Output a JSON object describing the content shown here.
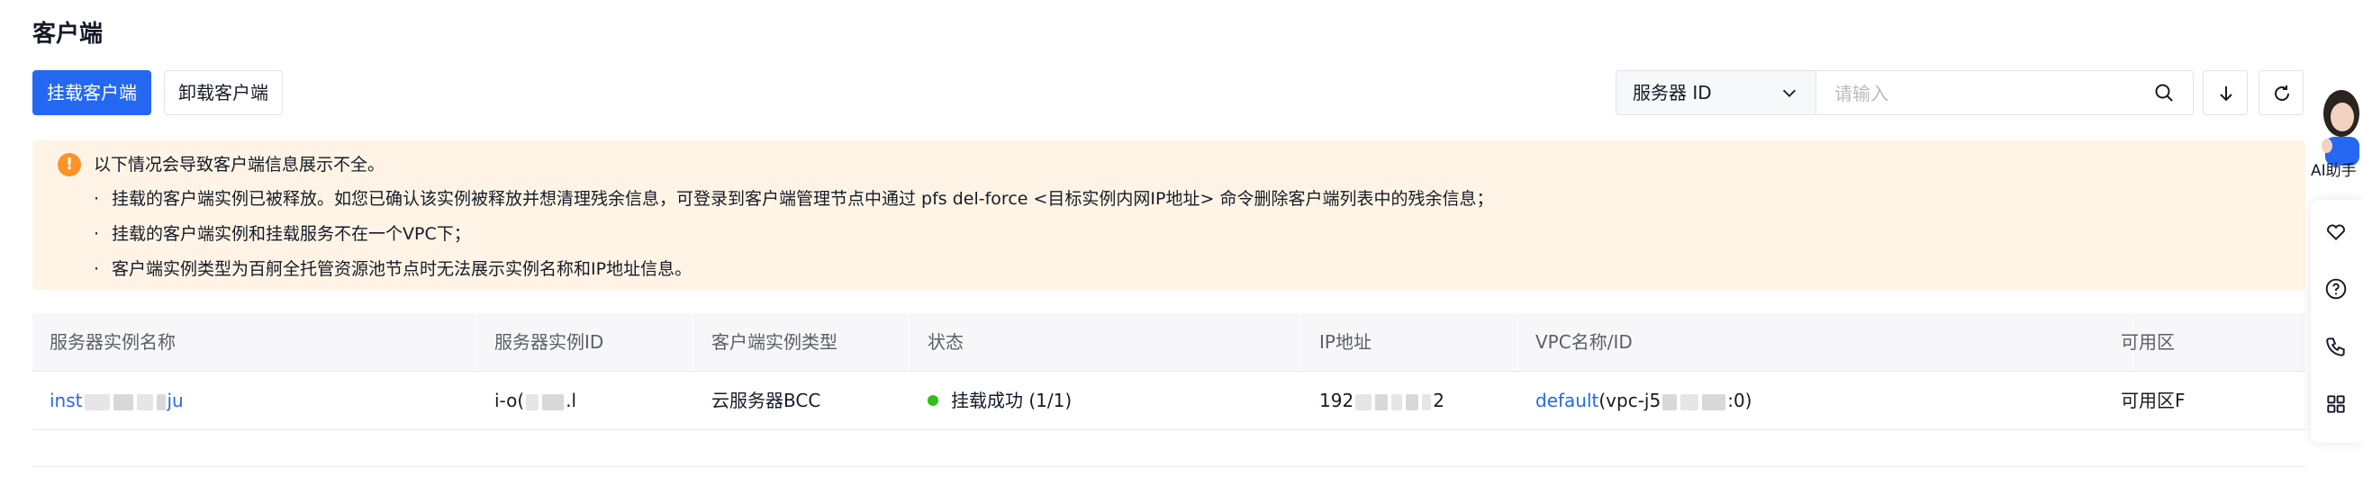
{
  "page": {
    "title": "客户端"
  },
  "toolbar": {
    "mount_button": "挂载客户端",
    "unmount_button": "卸载客户端",
    "filter_select": "服务器 ID",
    "search_placeholder": "请输入"
  },
  "alert": {
    "heading": "以下情况会导致客户端信息展示不全。",
    "items": [
      "挂载的客户端实例已被释放。如您已确认该实例被释放并想清理残余信息，可登录到客户端管理节点中通过 pfs del-force <目标实例内网IP地址> 命令删除客户端列表中的残余信息；",
      "挂载的客户端实例和挂载服务不在一个VPC下；",
      "客户端实例类型为百舸全托管资源池节点时无法展示实例名称和IP地址信息。"
    ],
    "bullet": "·"
  },
  "table": {
    "columns": [
      "服务器实例名称",
      "服务器实例ID",
      "客户端实例类型",
      "状态",
      "IP地址",
      "VPC名称/ID",
      "可用区"
    ],
    "rows": [
      {
        "name_prefix": "inst",
        "name_suffix": "ju",
        "id_prefix": "i-o(",
        "id_suffix": ".l",
        "type": "云服务器BCC",
        "status": "挂载成功 (1/1)",
        "ip_prefix": "192",
        "ip_suffix": "2",
        "vpc_name": "default",
        "vpc_id_prefix": "(vpc-j5",
        "vpc_id_suffix": ":0)",
        "zone": "可用区F"
      }
    ]
  },
  "assistant": {
    "label": "AI助手"
  },
  "colors": {
    "primary": "#2468f2",
    "warning": "#ff9326",
    "alert_bg": "#fff4e6",
    "success": "#30bf13"
  },
  "icons": [
    "chevron-down-icon",
    "search-icon",
    "download-icon",
    "refresh-icon",
    "warning-icon",
    "favorite-icon",
    "help-icon",
    "phone-icon",
    "apps-icon"
  ]
}
